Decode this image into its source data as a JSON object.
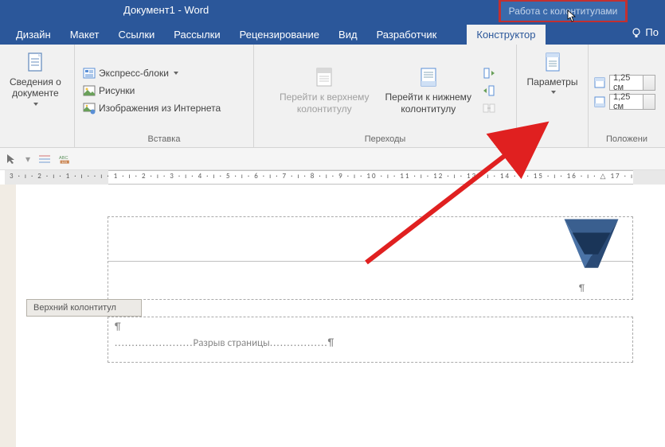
{
  "title": "Документ1 - Word",
  "context_tab": "Работа с колонтитулами",
  "tabs": [
    "Дизайн",
    "Макет",
    "Ссылки",
    "Рассылки",
    "Рецензирование",
    "Вид",
    "Разработчик",
    "Конструктор"
  ],
  "active_tab": "Конструктор",
  "tell_me": "По",
  "ribbon": {
    "g1": {
      "doc_info": "Сведения о\nдокументе",
      "quick_parts": "Экспресс-блоки",
      "pictures": "Рисунки",
      "online_pics": "Изображения из Интернета",
      "label": "Вставка"
    },
    "g2": {
      "prev": "Перейти к верхнему\nколонтитулу",
      "next": "Перейти к нижнему\nколонтитулу",
      "label": "Переходы"
    },
    "g3": {
      "options": "Параметры",
      "label": ""
    },
    "g4": {
      "v1": "1,25 см",
      "v2": "1,25 см",
      "label": "Положени"
    }
  },
  "ruler_text": "3 · ı · 2 · ı · 1 · ı ·     · ı · 1 · ı · 2 · ı · 3 · ı · 4 · ı · 5 · ı · 6 · ı · 7 · ı · 8 · ı · 9 · ı · 10 · ı · 11 · ı · 12 · ı · 13 · ı · 14 · ı · 15 · ı · 16 · ı · △ 17 · ı",
  "header_tag": "Верхний колонтитул",
  "para_mark": "¶",
  "page_break": "Разрыв страницы"
}
